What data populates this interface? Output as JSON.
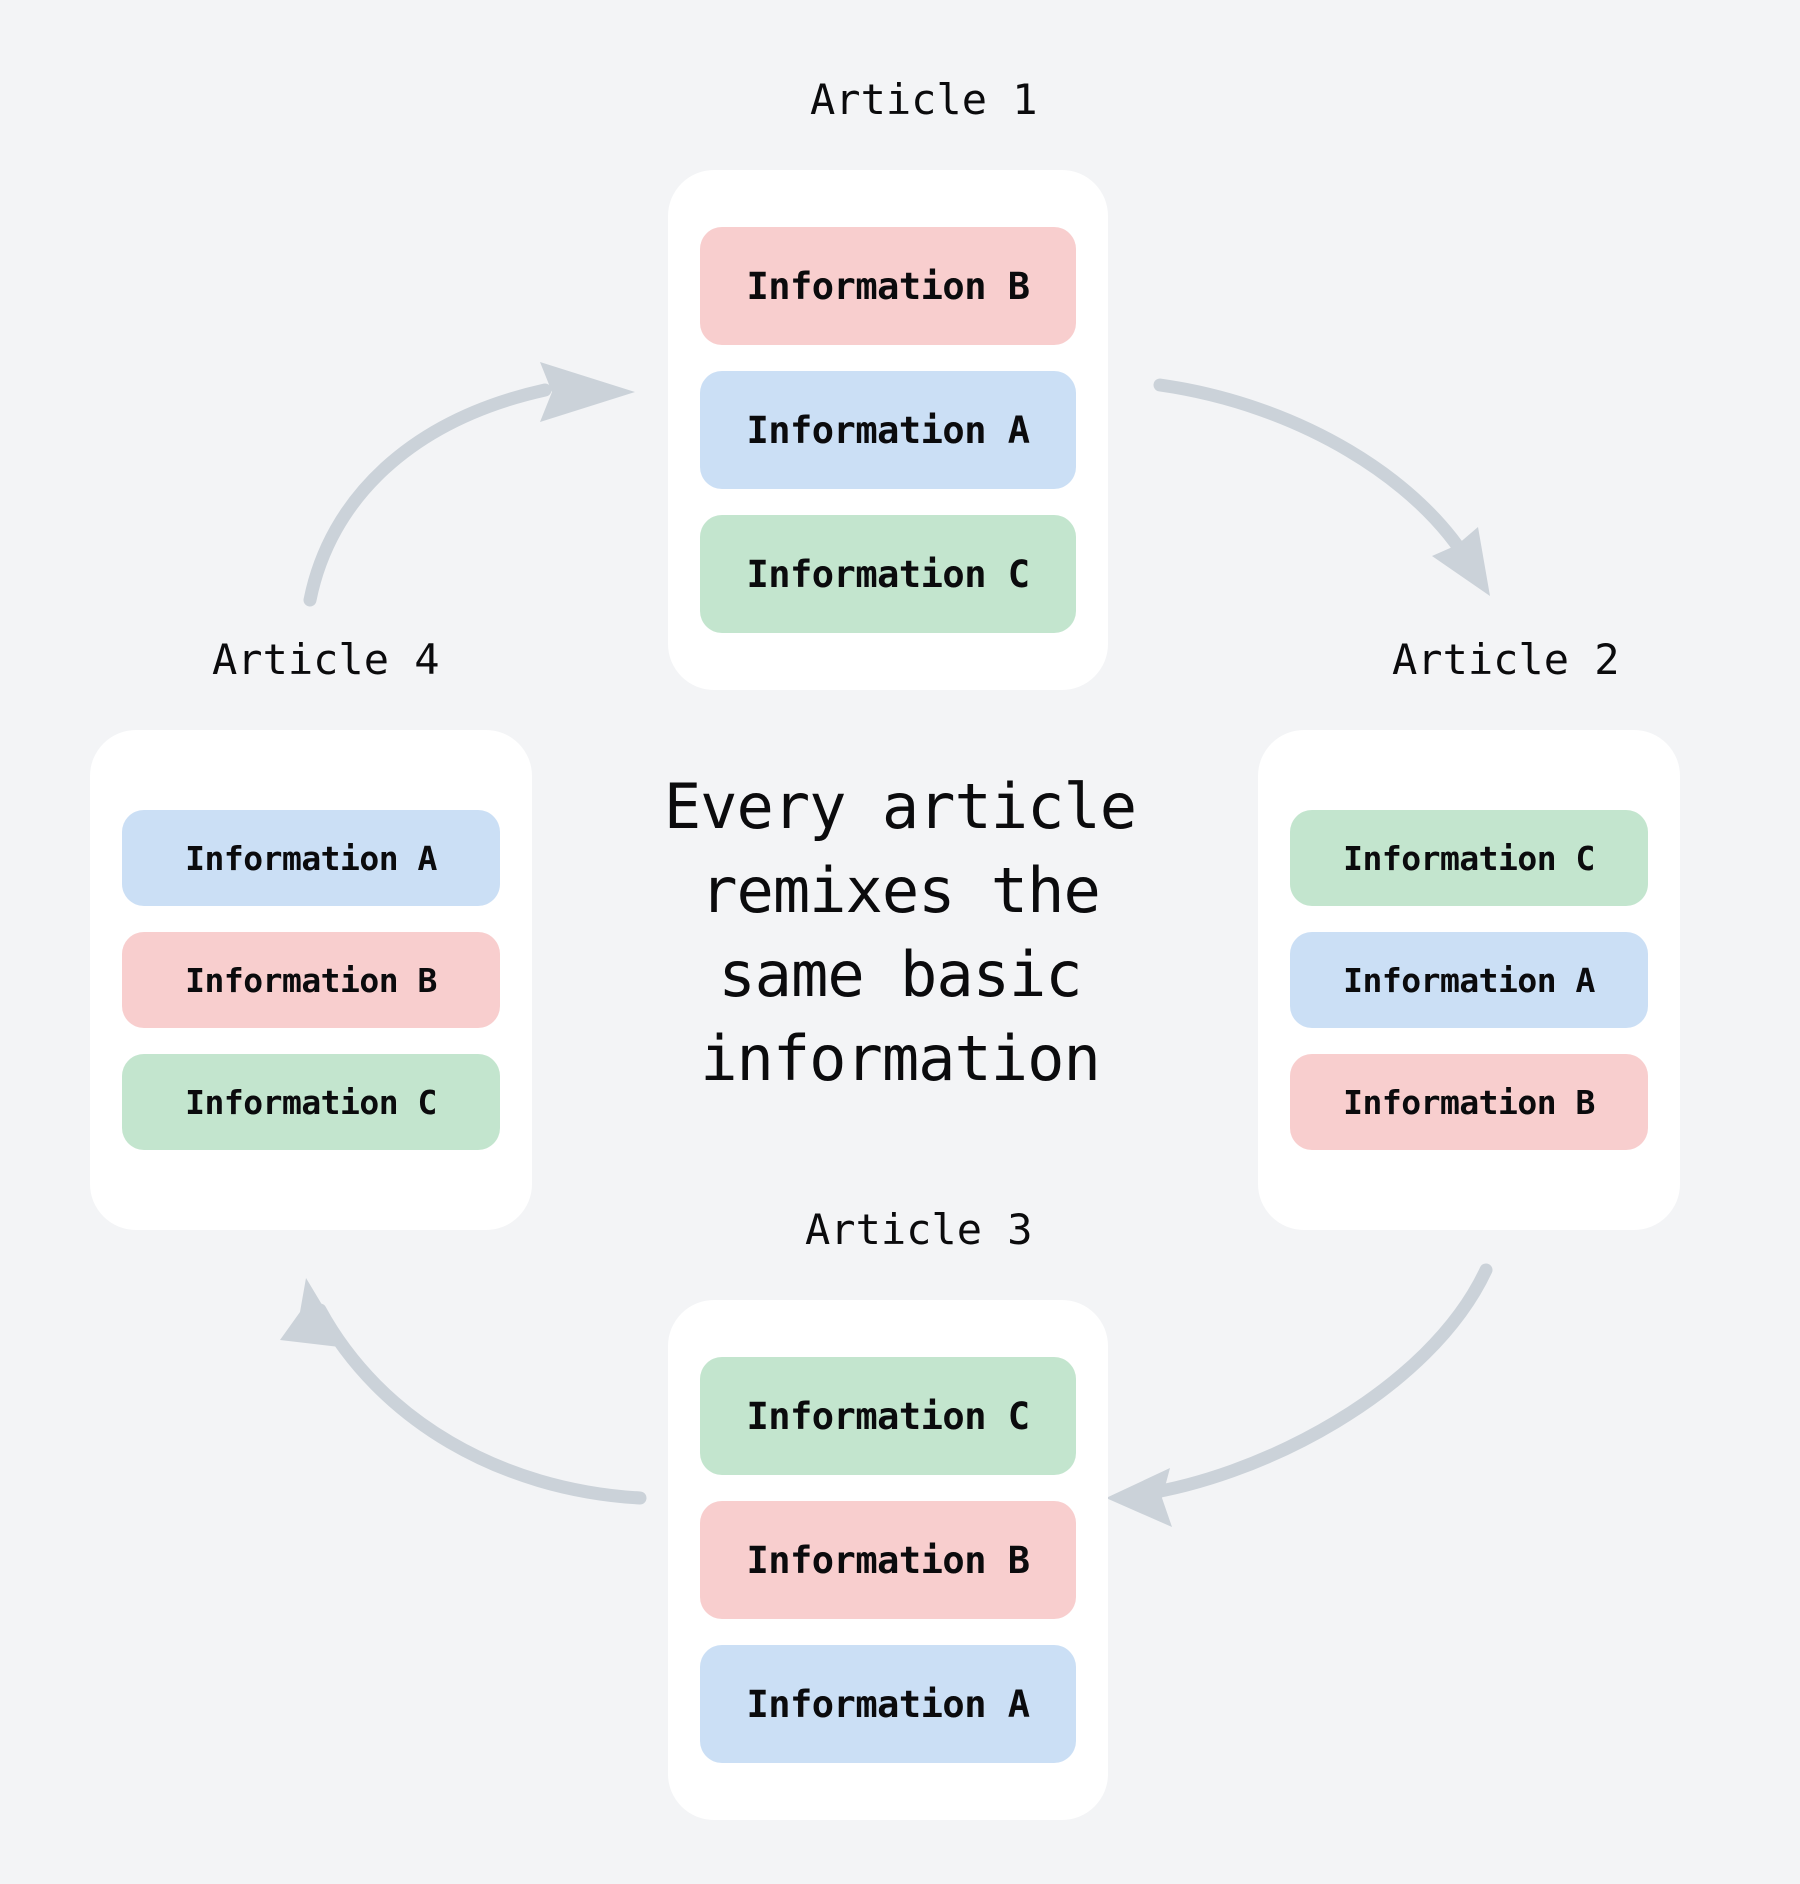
{
  "canvas": {
    "background": "#F3F4F6",
    "card_background": "#FFFFFF",
    "arrow_color": "#CBD2D9"
  },
  "center": {
    "text": "Every article remixes the same basic information"
  },
  "palette": {
    "information_a": "#CBDFF5",
    "information_b": "#F8CECE",
    "information_c": "#C3E5CE"
  },
  "cards": [
    {
      "id": "card-1",
      "label": "Article 1",
      "items": [
        {
          "text": "Information B",
          "color": "#F8CECE"
        },
        {
          "text": "Information A",
          "color": "#CBDFF5"
        },
        {
          "text": "Information C",
          "color": "#C3E5CE"
        }
      ]
    },
    {
      "id": "card-2",
      "label": "Article 2",
      "items": [
        {
          "text": "Information C",
          "color": "#C3E5CE"
        },
        {
          "text": "Information A",
          "color": "#CBDFF5"
        },
        {
          "text": "Information B",
          "color": "#F8CECE"
        }
      ]
    },
    {
      "id": "card-3",
      "label": "Article 3",
      "items": [
        {
          "text": "Information C",
          "color": "#C3E5CE"
        },
        {
          "text": "Information B",
          "color": "#F8CECE"
        },
        {
          "text": "Information A",
          "color": "#CBDFF5"
        }
      ]
    },
    {
      "id": "card-4",
      "label": "Article 4",
      "items": [
        {
          "text": "Information A",
          "color": "#CBDFF5"
        },
        {
          "text": "Information B",
          "color": "#F8CECE"
        },
        {
          "text": "Information C",
          "color": "#C3E5CE"
        }
      ]
    }
  ],
  "arrows": [
    {
      "name": "arrow-article4-to-article1",
      "from": "Article 4",
      "to": "Article 1"
    },
    {
      "name": "arrow-article1-to-article2",
      "from": "Article 1",
      "to": "Article 2"
    },
    {
      "name": "arrow-article2-to-article3",
      "from": "Article 2",
      "to": "Article 3"
    },
    {
      "name": "arrow-article3-to-article4",
      "from": "Article 3",
      "to": "Article 4"
    }
  ]
}
